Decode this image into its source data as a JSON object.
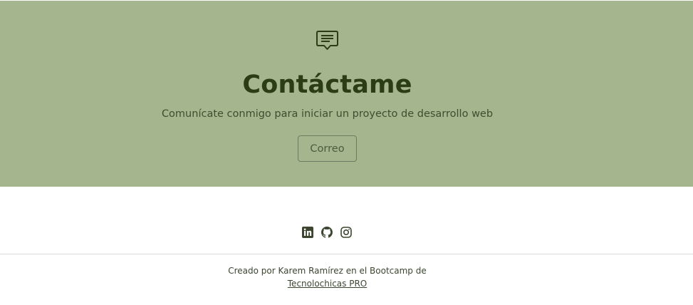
{
  "hero": {
    "icon": "chat-message-icon",
    "title": "Contáctame",
    "subtitle": "Comunícate conmigo para iniciar un proyecto de desarrollo web",
    "button_label": "Correo",
    "background_color": "#a5b58e",
    "title_color": "#2a3d13"
  },
  "social": {
    "icons": [
      "linkedin-icon",
      "github-icon",
      "instagram-icon"
    ]
  },
  "footer": {
    "credit_text": "Creado por Karem Ramírez en el Bootcamp de",
    "credit_link": "Tecnolochicas PRO"
  }
}
